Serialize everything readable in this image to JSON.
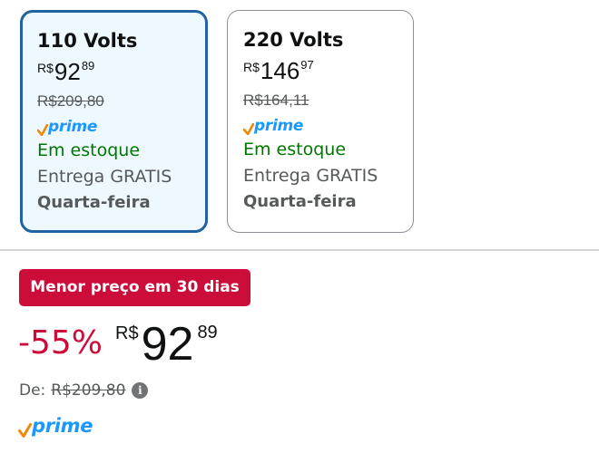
{
  "colors": {
    "selected_border": "#2162a1",
    "selected_bg": "#edf8ff",
    "deal_red": "#cc0c39",
    "in_stock_green": "#007600",
    "prime_blue": "#1a98ff",
    "prime_check_orange": "#f08804"
  },
  "options": [
    {
      "title": "110 Volts",
      "selected": true,
      "price": {
        "currency": "R$",
        "whole": "92",
        "cents": "89"
      },
      "list_price": "R$209,80",
      "prime": "prime",
      "stock": "Em estoque",
      "delivery": "Entrega GRATIS",
      "delivery_day": "Quarta-feira"
    },
    {
      "title": "220 Volts",
      "selected": false,
      "price": {
        "currency": "R$",
        "whole": "146",
        "cents": "97"
      },
      "list_price": "R$164,11",
      "prime": "prime",
      "stock": "Em estoque",
      "delivery": "Entrega GRATIS",
      "delivery_day": "Quarta-feira"
    }
  ],
  "deal": {
    "badge": "Menor preço em 30 dias",
    "discount": "-55%",
    "price": {
      "currency": "R$",
      "whole": "92",
      "cents": "89"
    },
    "list_label": "De:",
    "list_price": "R$209,80",
    "info_icon": "info-icon",
    "prime": "prime"
  }
}
